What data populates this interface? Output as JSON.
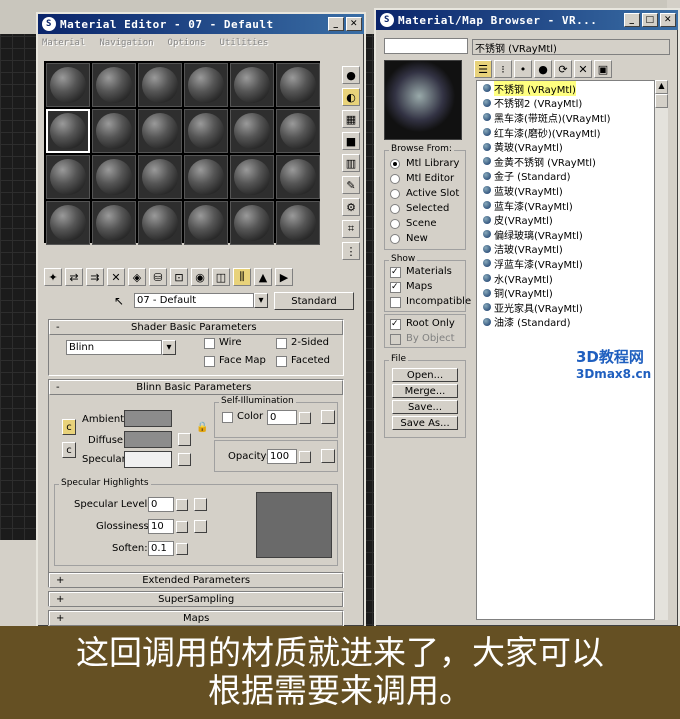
{
  "mat_editor": {
    "title": "Material Editor - 07 - Default",
    "menu": [
      "Material",
      "Navigation",
      "Options",
      "Utilities"
    ],
    "mat_name": "07 - Default",
    "mat_type": "Standard",
    "shader_header": "Shader Basic Parameters",
    "shader": "Blinn",
    "wire": "Wire",
    "two_sided": "2-Sided",
    "face_map": "Face Map",
    "faceted": "Faceted",
    "blinn_header": "Blinn Basic Parameters",
    "self_illum": "Self-Illumination",
    "color_label": "Color",
    "color_value": "0",
    "ambient": "Ambient:",
    "diffuse": "Diffuse:",
    "specular": "Specular:",
    "opacity_label": "Opacity:",
    "opacity_value": "100",
    "spec_highlights": "Specular Highlights",
    "spec_level_label": "Specular Level:",
    "spec_level": "0",
    "gloss_label": "Glossiness:",
    "gloss": "10",
    "soften_label": "Soften:",
    "soften": "0.1",
    "extended": "Extended Parameters",
    "supersampling": "SuperSampling",
    "maps": "Maps"
  },
  "browser": {
    "title": "Material/Map Browser - VR...",
    "search_value": "",
    "preview_name": "不锈钢 (VRayMtl)",
    "browse_from_label": "Browse From:",
    "browse_from": [
      "Mtl Library",
      "Mtl Editor",
      "Active Slot",
      "Selected",
      "Scene",
      "New"
    ],
    "show_label": "Show",
    "show": [
      "Materials",
      "Maps",
      "Incompatible"
    ],
    "root_only": "Root Only",
    "by_object": "By Object",
    "file_label": "File",
    "file_buttons": [
      "Open...",
      "Merge...",
      "Save...",
      "Save As..."
    ],
    "items": [
      "不锈钢 (VRayMtl)",
      "不锈钢2 (VRayMtl)",
      "黑车漆(带斑点)(VRayMtl)",
      "红车漆(磨砂)(VRayMtl)",
      "黄玻(VRayMtl)",
      "金黄不锈钢 (VRayMtl)",
      "金子 (Standard)",
      "蓝玻(VRayMtl)",
      "蓝车漆(VRayMtl)",
      "皮(VRayMtl)",
      "偏绿玻璃(VRayMtl)",
      "洁玻(VRayMtl)",
      "浮蓝车漆(VRayMtl)",
      "水(VRayMtl)",
      "铜(VRayMtl)",
      "亚光家具(VRayMtl)",
      "油漆 (Standard)"
    ]
  },
  "watermark": {
    "line1": "3D教程网",
    "line2": "3Dmax8.cn"
  },
  "caption": {
    "line1": "这回调用的材质就进来了，大家可以",
    "line2": "根据需要来调用。"
  },
  "colors": {
    "titlebar": "#0a246a",
    "panel": "#d4d0c8",
    "caption_bg": "#655023",
    "highlight": "#ffff80"
  }
}
